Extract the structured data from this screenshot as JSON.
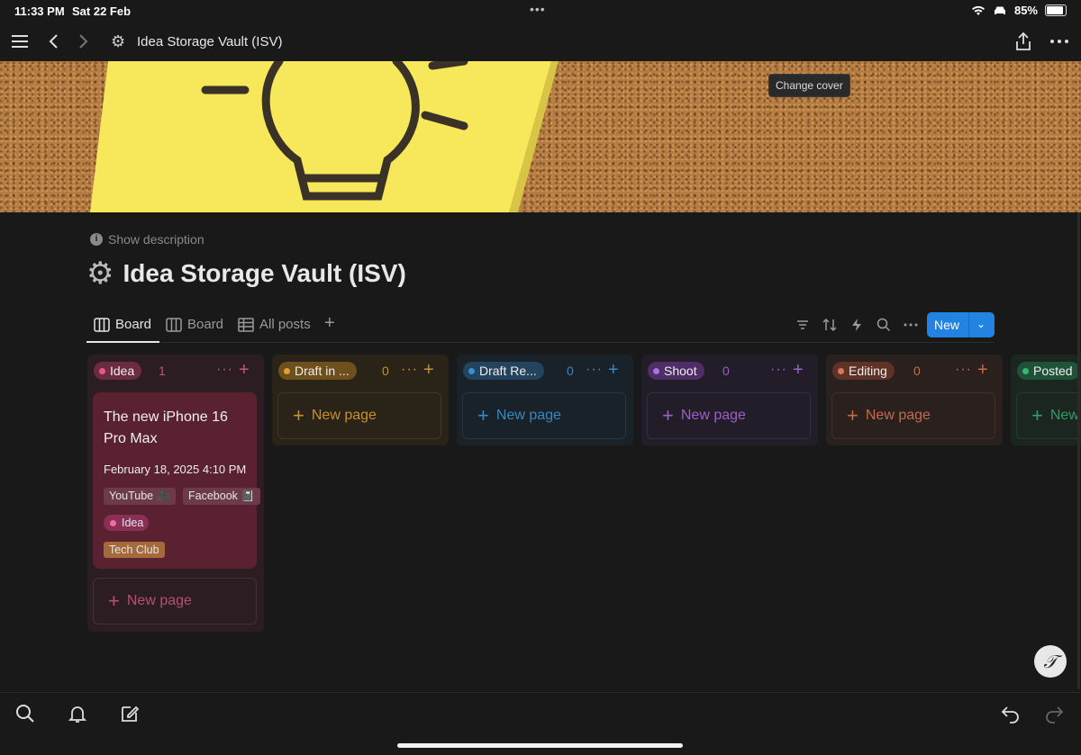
{
  "status": {
    "time": "11:33 PM",
    "date": "Sat 22 Feb",
    "battery": "85%"
  },
  "topbar": {
    "title": "Idea Storage Vault (ISV)"
  },
  "cover": {
    "change_label": "Change cover"
  },
  "page": {
    "show_description": "Show description",
    "title": "Idea Storage Vault (ISV)",
    "icon": "gear-icon"
  },
  "views": {
    "items": [
      {
        "label": "Board"
      },
      {
        "label": "Board"
      },
      {
        "label": "All posts"
      }
    ],
    "new_label": "New"
  },
  "columns": [
    {
      "name": "Idea",
      "count": "1",
      "color": "#d9497d",
      "new_page": "New page"
    },
    {
      "name": "Draft in ...",
      "count": "0",
      "color": "#d4921e",
      "new_page": "New page"
    },
    {
      "name": "Draft Re...",
      "count": "0",
      "color": "#2f86c7",
      "new_page": "New page"
    },
    {
      "name": "Shoot",
      "count": "0",
      "color": "#a45bd1",
      "new_page": "New page"
    },
    {
      "name": "Editing",
      "count": "0",
      "color": "#d0684a",
      "new_page": "New page"
    },
    {
      "name": "Posted",
      "count": "",
      "color": "#2fa86a",
      "new_page": "New"
    }
  ],
  "card": {
    "title": "The new iPhone 16 Pro Max",
    "date": "February 18, 2025 4:10 PM",
    "tags": [
      "YouTube 🎥",
      "Facebook 📓"
    ],
    "status_tag": "Idea",
    "club_tag": "Tech Club"
  },
  "fab": {
    "glyph": "𝒯"
  }
}
